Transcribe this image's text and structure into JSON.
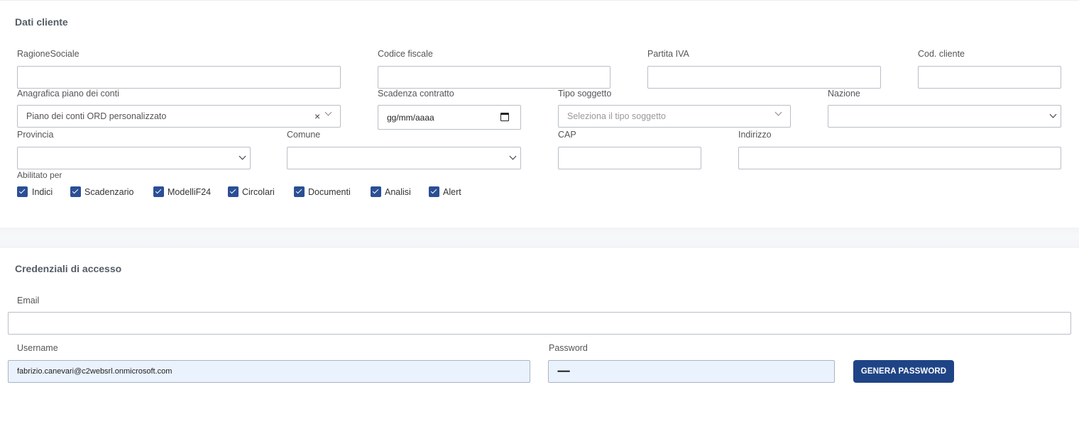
{
  "client_section": {
    "title": "Dati cliente",
    "ragione_sociale": {
      "label": "RagioneSociale",
      "value": ""
    },
    "codice_fiscale": {
      "label": "Codice fiscale",
      "value": ""
    },
    "partita_iva": {
      "label": "Partita IVA",
      "value": ""
    },
    "cod_cliente": {
      "label": "Cod. cliente",
      "value": ""
    },
    "anagrafica": {
      "label": "Anagrafica piano dei conti",
      "value": "Piano dei conti ORD personalizzato",
      "clear_icon": "×"
    },
    "scadenza": {
      "label": "Scadenza contratto",
      "placeholder": "gg/mm/aaaa"
    },
    "tipo_soggetto": {
      "label": "Tipo soggetto",
      "placeholder": "Seleziona il tipo soggetto"
    },
    "nazione": {
      "label": "Nazione",
      "value": ""
    },
    "provincia": {
      "label": "Provincia",
      "value": ""
    },
    "comune": {
      "label": "Comune",
      "value": ""
    },
    "cap": {
      "label": "CAP",
      "value": ""
    },
    "indirizzo": {
      "label": "Indirizzo",
      "value": ""
    },
    "abilitato": {
      "label": "Abilitato per",
      "items": [
        {
          "label": "Indici",
          "checked": true
        },
        {
          "label": "Scadenzario",
          "checked": true
        },
        {
          "label": "ModelliF24",
          "checked": true
        },
        {
          "label": "Circolari",
          "checked": true
        },
        {
          "label": "Documenti",
          "checked": true
        },
        {
          "label": "Analisi",
          "checked": true
        },
        {
          "label": "Alert",
          "checked": true
        }
      ]
    }
  },
  "credentials_section": {
    "title": "Credenziali di accesso",
    "email": {
      "label": "Email",
      "value": ""
    },
    "username": {
      "label": "Username",
      "value": "fabrizio.canevari@c2websrl.onmicrosoft.com"
    },
    "password": {
      "label": "Password",
      "value": "••••••••"
    },
    "generate_button": "GENERA PASSWORD"
  },
  "colors": {
    "accent": "#1f4486",
    "checkbox": "#2b4f95",
    "autofill_bg": "#eaf2fd"
  },
  "icons": [
    "chevron-down-icon",
    "close-icon",
    "calendar-icon",
    "check-icon"
  ]
}
